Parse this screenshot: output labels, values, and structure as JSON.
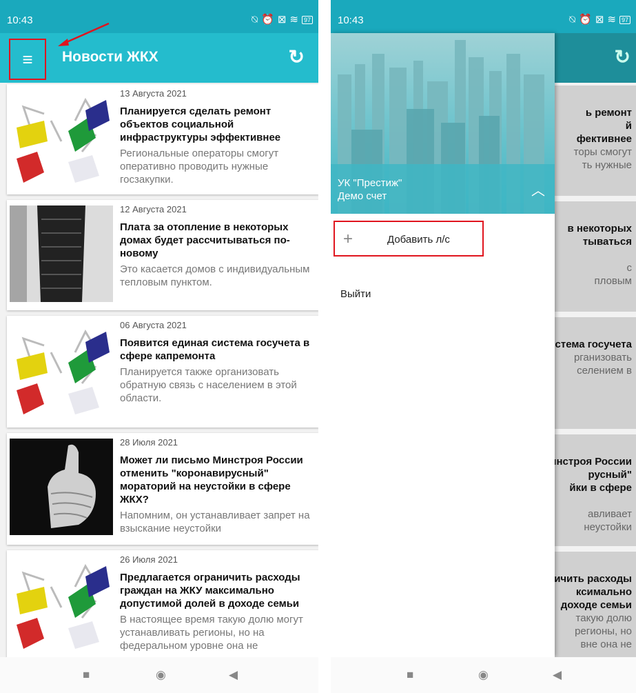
{
  "status_bar": {
    "time": "10:43",
    "battery": "97"
  },
  "app_bar": {
    "title": "Новости ЖКХ"
  },
  "news": [
    {
      "date": "13 Августа 2021",
      "title": "Планируется сделать ремонт объектов социальной инфраструктуры эффективнее",
      "summary": "Региональные операторы смогут оперативно проводить нужные госзакупки.",
      "image": "binder-clips"
    },
    {
      "date": "12 Августа 2021",
      "title": "Плата за отопление в некоторых домах будет рассчитываться по-новому",
      "summary": "Это касается домов с индивидуальным тепловым пунктом.",
      "image": "stairs"
    },
    {
      "date": "06 Августа 2021",
      "title": "Появится единая система госучета в сфере капремонта",
      "summary": "Планируется также организовать обратную связь с населением в этой области.",
      "image": "binder-clips"
    },
    {
      "date": "28 Июля 2021",
      "title": "Может ли письмо Минстроя России отменить \"коронавирусный\" мораторий на неустойки в сфере ЖКХ?",
      "summary": "Напомним, он устанавливает запрет на взыскание неустойки",
      "image": "thumbs-up"
    },
    {
      "date": "26 Июля 2021",
      "title": "Предлагается ограничить расходы граждан на ЖКУ максимально допустимой долей в доходе семьи",
      "summary": "В настоящее время такую долю могут устанавливать регионы, но на федеральном уровне она не",
      "image": "binder-clips"
    }
  ],
  "drawer": {
    "organization": "УК \"Престиж\"",
    "account": "Демо счет",
    "add_account": "Добавить л/с",
    "logout": "Выйти"
  },
  "bg_fragments": [
    {
      "lines": [
        "ь ремонт",
        "й",
        "фективнее"
      ],
      "gray": [
        "торы смогут",
        "ть нужные"
      ]
    },
    {
      "lines": [
        "в некоторых",
        "тываться"
      ],
      "gray": [
        "с",
        "пловым"
      ]
    },
    {
      "lines": [
        "стема госучета"
      ],
      "gray": [
        "рганизовать",
        "селением в"
      ]
    },
    {
      "lines": [
        "инстроя России",
        "русный\"",
        "йки в сфере"
      ],
      "gray": [
        "авливает",
        "неустойки"
      ]
    },
    {
      "lines": [
        "ичить расходы",
        "ксимально",
        "доходе семьи"
      ],
      "gray": [
        "такую долю",
        "регионы, но",
        "вне она не"
      ]
    }
  ],
  "colors": {
    "primary": "#24bccd",
    "status": "#1aa9bd",
    "highlight": "#e0141e"
  }
}
